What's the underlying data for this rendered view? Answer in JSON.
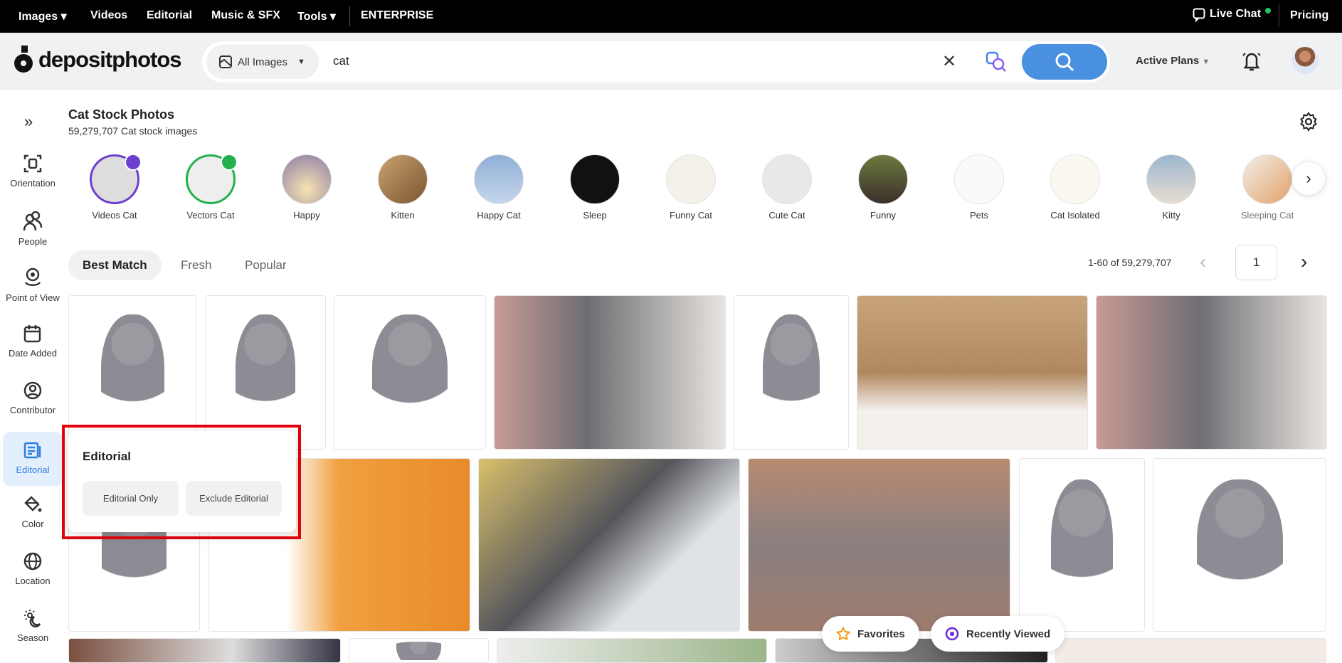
{
  "topnav": {
    "items": [
      "Images ▾",
      "Videos",
      "Editorial",
      "Music & SFX",
      "Tools ▾"
    ],
    "enterprise": "ENTERPRISE",
    "live_chat": "Live Chat",
    "pricing": "Pricing",
    "live_color": "#22c55e"
  },
  "header": {
    "logo": "depositphotos",
    "scope": "All Images",
    "query": "cat",
    "active_plans": "Active Plans",
    "accent": "#4a90e0"
  },
  "sidebar": {
    "items": [
      "Orientation",
      "People",
      "Point of View",
      "Date Added",
      "Contributor",
      "Editorial",
      "Color",
      "Location",
      "Season"
    ],
    "active": "Editorial"
  },
  "page": {
    "title": "Cat Stock Photos",
    "subtitle": "59,279,707 Cat stock images"
  },
  "chips": [
    "Videos Cat",
    "Vectors Cat",
    "Happy",
    "Kitten",
    "Happy Cat",
    "Sleep",
    "Funny Cat",
    "Cute Cat",
    "Funny",
    "Pets",
    "Cat Isolated",
    "Kitty",
    "Sleeping Cat"
  ],
  "tabs": [
    "Best Match",
    "Fresh",
    "Popular"
  ],
  "pagination": {
    "range": "1-60 of 59,279,707",
    "page": "1"
  },
  "popup": {
    "title": "Editorial",
    "options": [
      "Editorial Only",
      "Exclude Editorial"
    ]
  },
  "floating": {
    "favorites": "Favorites",
    "recent": "Recently Viewed"
  }
}
